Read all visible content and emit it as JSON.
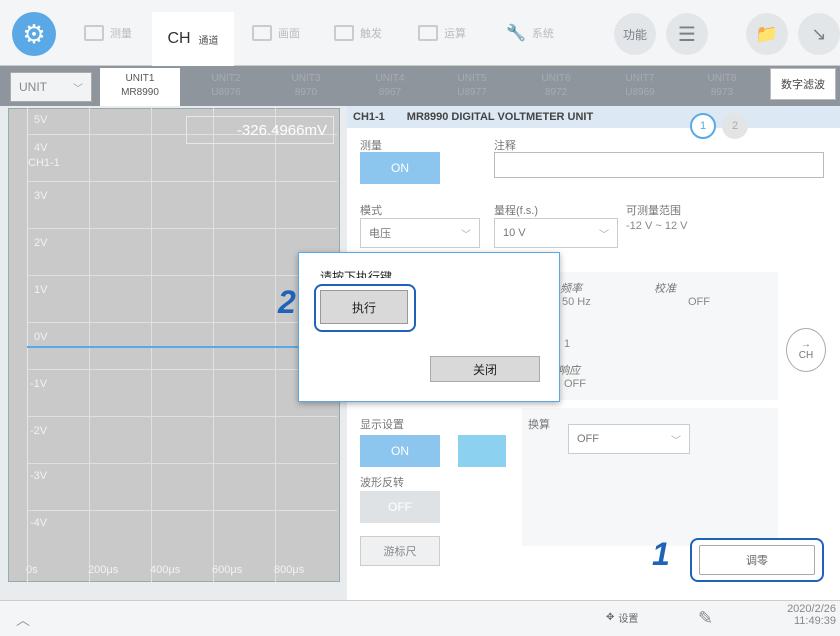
{
  "topbar": {
    "tabs": [
      "测量",
      "通道",
      "画面",
      "触发",
      "运算",
      "系统"
    ],
    "ch_label": "CH",
    "func_label": "功能"
  },
  "unit_row": {
    "select_value": "UNIT",
    "units": [
      {
        "name": "UNIT1",
        "model": "MR8990"
      },
      {
        "name": "UNIT2",
        "model": "U8976"
      },
      {
        "name": "UNIT3",
        "model": "8970"
      },
      {
        "name": "UNIT4",
        "model": "8967"
      },
      {
        "name": "UNIT5",
        "model": "U8977"
      },
      {
        "name": "UNIT6",
        "model": "8972"
      },
      {
        "name": "UNIT7",
        "model": "U8969"
      },
      {
        "name": "UNIT8",
        "model": "8973"
      }
    ],
    "digital_filter": "数字滤波"
  },
  "waveform": {
    "readout": "-326.4966mV",
    "channel": "CH1-1",
    "v_labels": [
      "5V",
      "4V",
      "3V",
      "2V",
      "1V",
      "0V",
      "-1V",
      "-2V",
      "-3V",
      "-4V"
    ],
    "t_labels": [
      "0s",
      "200μs",
      "400μs",
      "600μs",
      "800μs"
    ]
  },
  "panel": {
    "ch_id": "CH1-1",
    "unit_title": "MR8990 DIGITAL VOLTMETER UNIT",
    "page1": "1",
    "page2": "2",
    "measure_label": "测量",
    "measure_value": "ON",
    "comment_label": "注释",
    "mode_label": "模式",
    "mode_value": "电压",
    "range_label": "量程(f.s.)",
    "range_value": "10 V",
    "measurable_label": "可测量范围",
    "measurable_value": "-12 V ~ 12 V",
    "freq_label": "频率",
    "freq_value": "50 Hz",
    "calib_label": "校准",
    "calib_value": "OFF",
    "misc_value": "1",
    "misc2_label": "响应",
    "misc2_value": "OFF",
    "display_label": "显示设置",
    "display_value": "ON",
    "invert_label": "波形反转",
    "invert_value": "OFF",
    "cursor_label": "游标尺",
    "convert_label": "换算",
    "convert_value": "OFF",
    "zero_label": "调零",
    "ch_nav_label": "CH",
    "display_color": "#8cd1ef"
  },
  "dialog": {
    "message": "请按下执行键",
    "execute": "执行",
    "close": "关闭"
  },
  "steps": {
    "step1": "1",
    "step2": "2"
  },
  "bottom": {
    "settings_label": "设置",
    "date": "2020/2/26",
    "time": "11:49:39"
  }
}
